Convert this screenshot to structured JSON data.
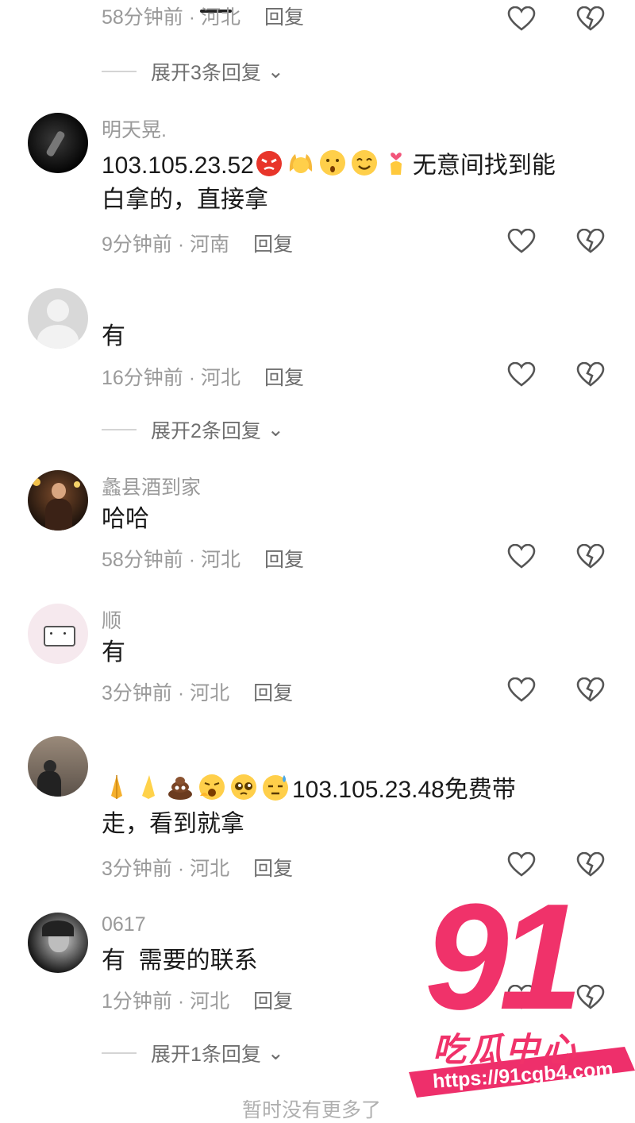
{
  "colors": {
    "meta": "#9a9a9a",
    "text": "#1a1a1a",
    "brand_pink": "#f0326a"
  },
  "top_partial": {
    "time": "58分钟前",
    "location": "河北",
    "reply": "回复"
  },
  "expand_3": "展开3条回复",
  "comments": [
    {
      "name": "明天晃.",
      "text_before": "103.105.23.52",
      "emoji": [
        "angry-face",
        "raising-hands",
        "face-with-open-eyes",
        "smiling-face",
        "finger-heart"
      ],
      "text_after": "无意间找到能",
      "text_line2": "白拿的，直接拿",
      "time": "9分钟前",
      "location": "河南",
      "reply": "回复"
    },
    {
      "name": "",
      "text": "有",
      "time": "16分钟前",
      "location": "河北",
      "reply": "回复"
    },
    {
      "name": "蠡县酒到家",
      "text": "哈哈",
      "time": "58分钟前",
      "location": "河北",
      "reply": "回复"
    },
    {
      "name": "顺",
      "text": "有",
      "time": "3分钟前",
      "location": "河北",
      "reply": "回复"
    },
    {
      "name": "",
      "emoji": [
        "folded-hands",
        "folded-hands-light",
        "pile-of-poo",
        "yawning-face",
        "pleading-face",
        "downcast-sweat-face"
      ],
      "text_after": "103.105.23.48免费带",
      "text_line2": "走，看到就拿",
      "time": "3分钟前",
      "location": "河北",
      "reply": "回复"
    },
    {
      "name": "0617",
      "text": "有  需要的联系",
      "time": "1分钟前",
      "location": "河北",
      "reply": "回复"
    }
  ],
  "expand_2": "展开2条回复",
  "expand_1": "展开1条回复",
  "bottom_partial": "暂时没有更多了",
  "watermark": {
    "number": "91",
    "tagline": "吃瓜中心",
    "url": "https://91cgb4.com"
  }
}
